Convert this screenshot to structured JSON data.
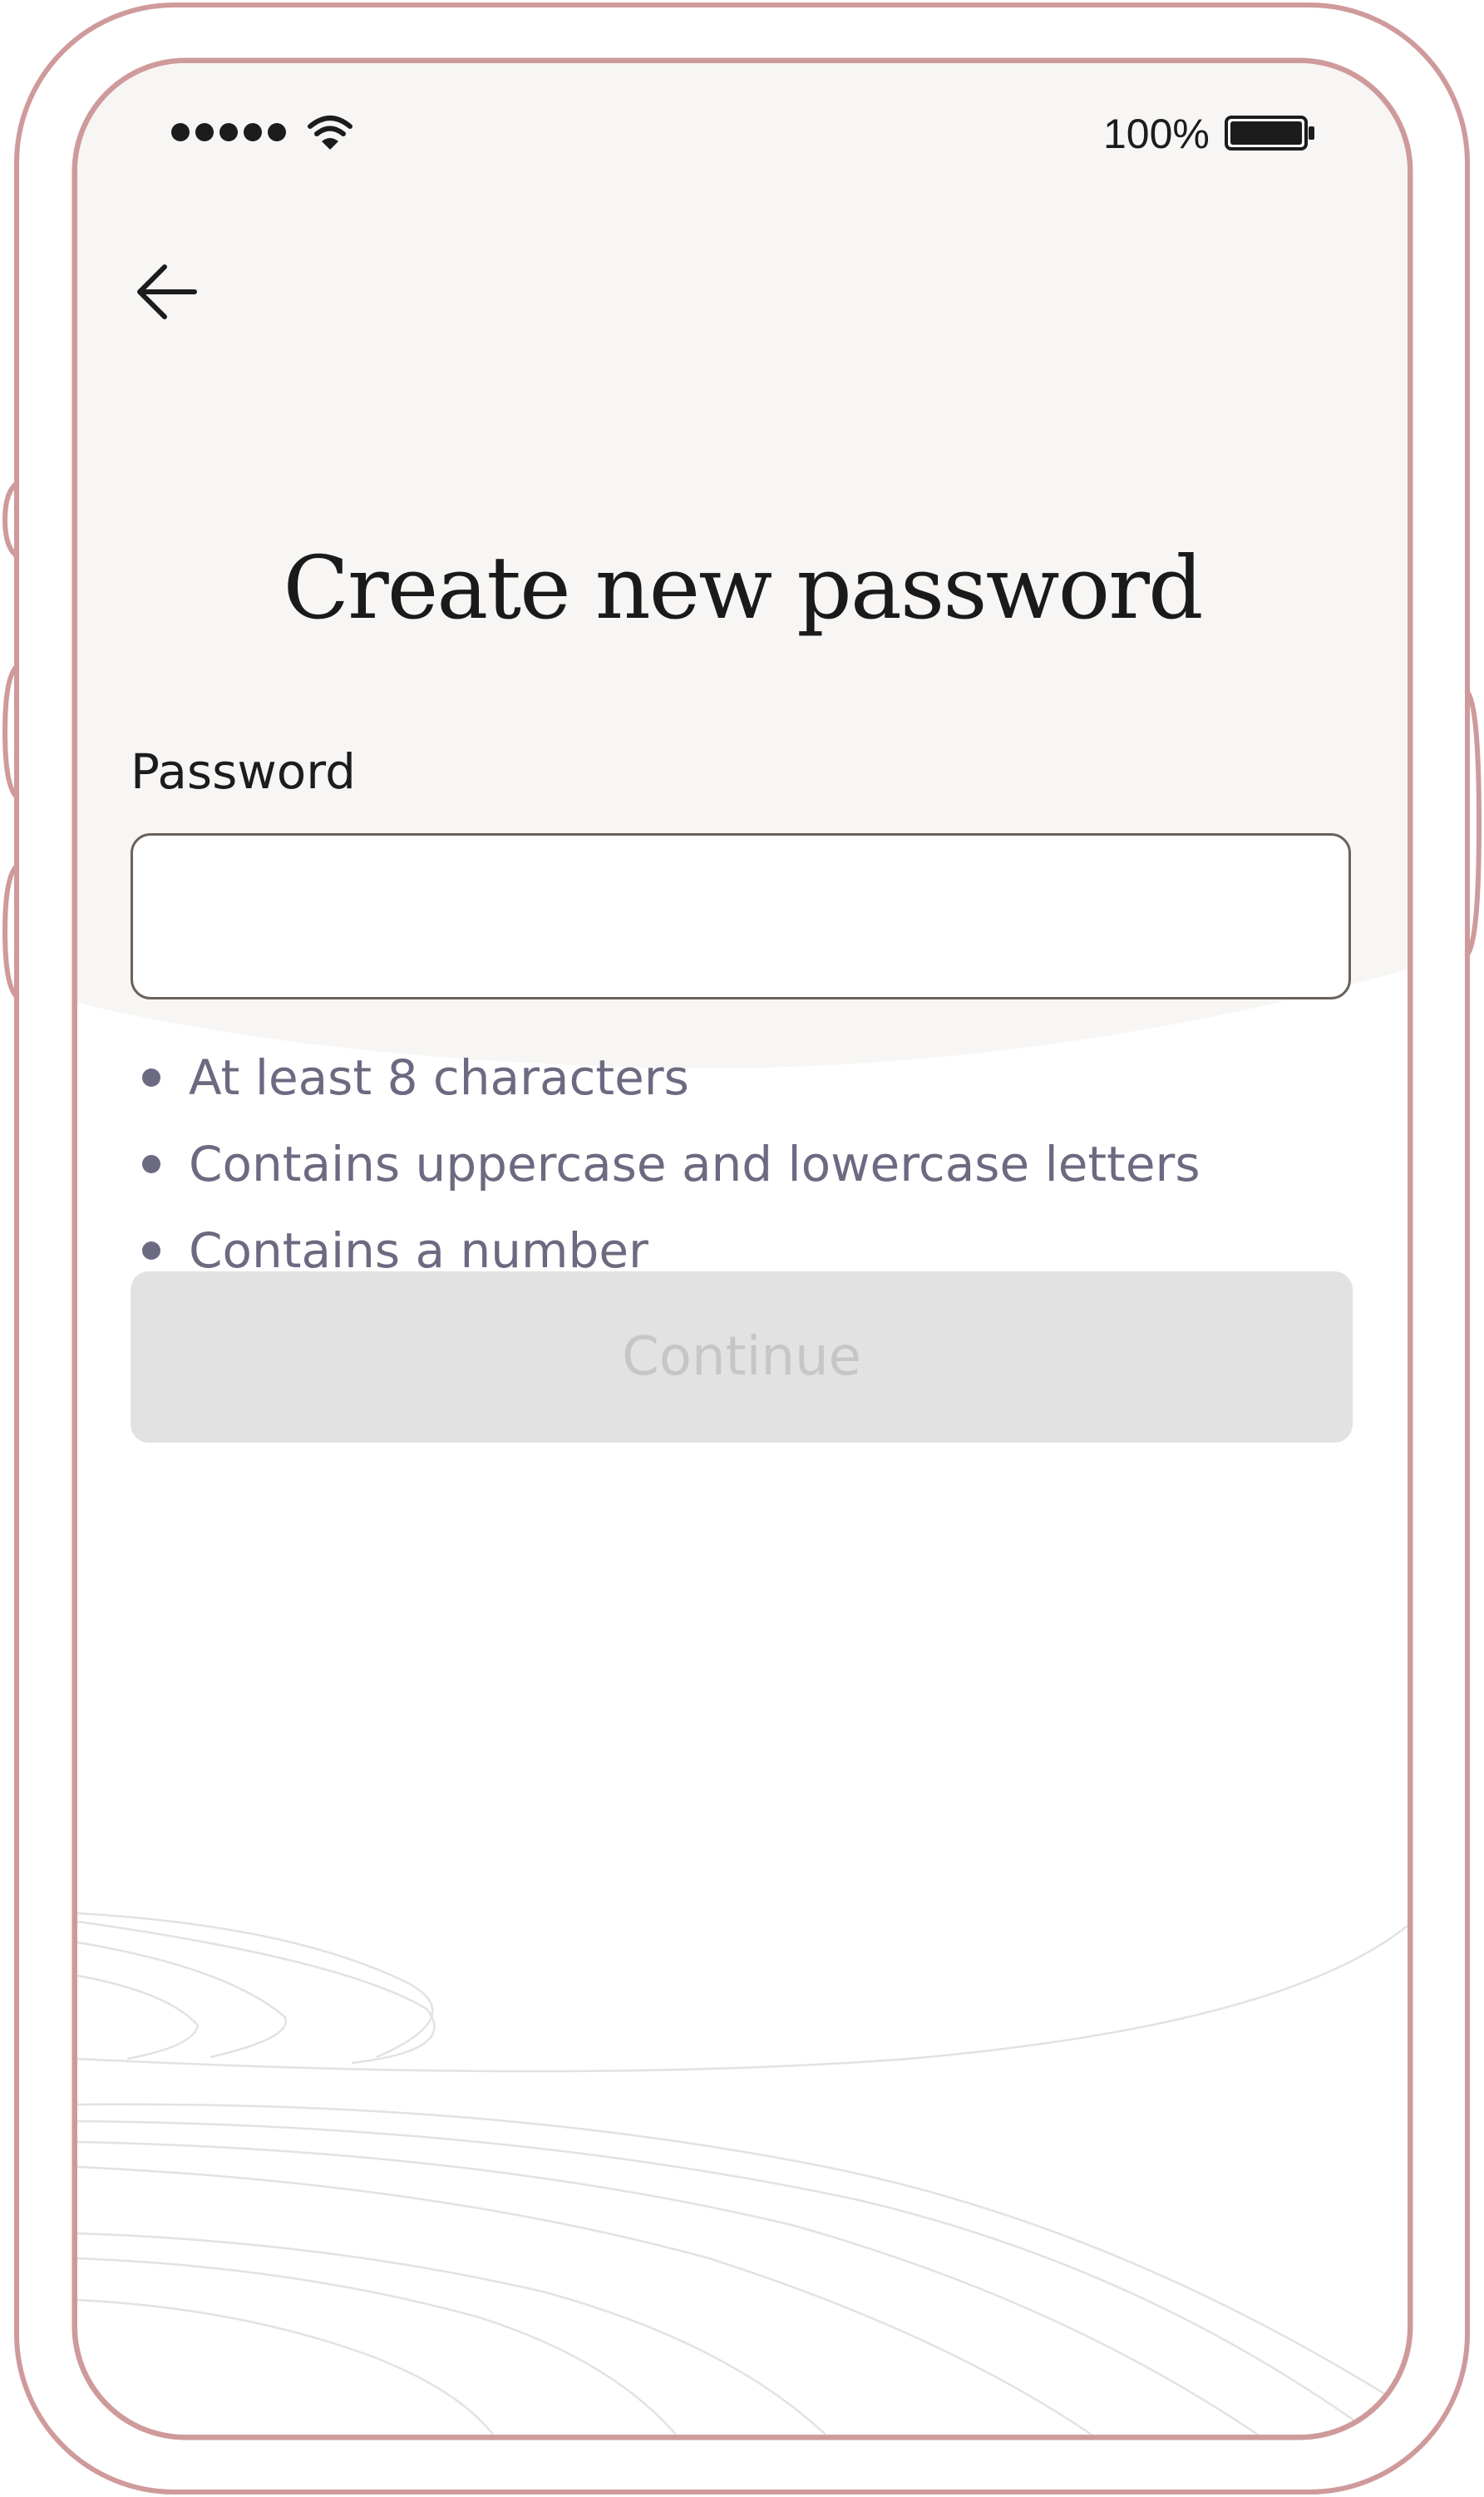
{
  "status_bar": {
    "battery_percent": "100%",
    "signal_dots": 5,
    "wifi_icon": "wifi-icon",
    "battery_icon": "battery-icon"
  },
  "nav": {
    "back_icon": "arrow-left-icon"
  },
  "screen": {
    "title": "Create new password"
  },
  "password_field": {
    "label": "Password",
    "value": "",
    "placeholder": ""
  },
  "requirements": [
    "At least 8 characters",
    "Contains uppercase and lowercase letters",
    "Contains a number"
  ],
  "continue_button": {
    "label": "Continue",
    "enabled": false
  },
  "colors": {
    "device_frame": "#cf9a9b",
    "header_background": "#f7f6f4",
    "hint_text": "#6c6a80",
    "button_disabled_bg": "#e2e2e2",
    "button_disabled_text": "#c6c6c6",
    "input_border": "#6b625c"
  }
}
